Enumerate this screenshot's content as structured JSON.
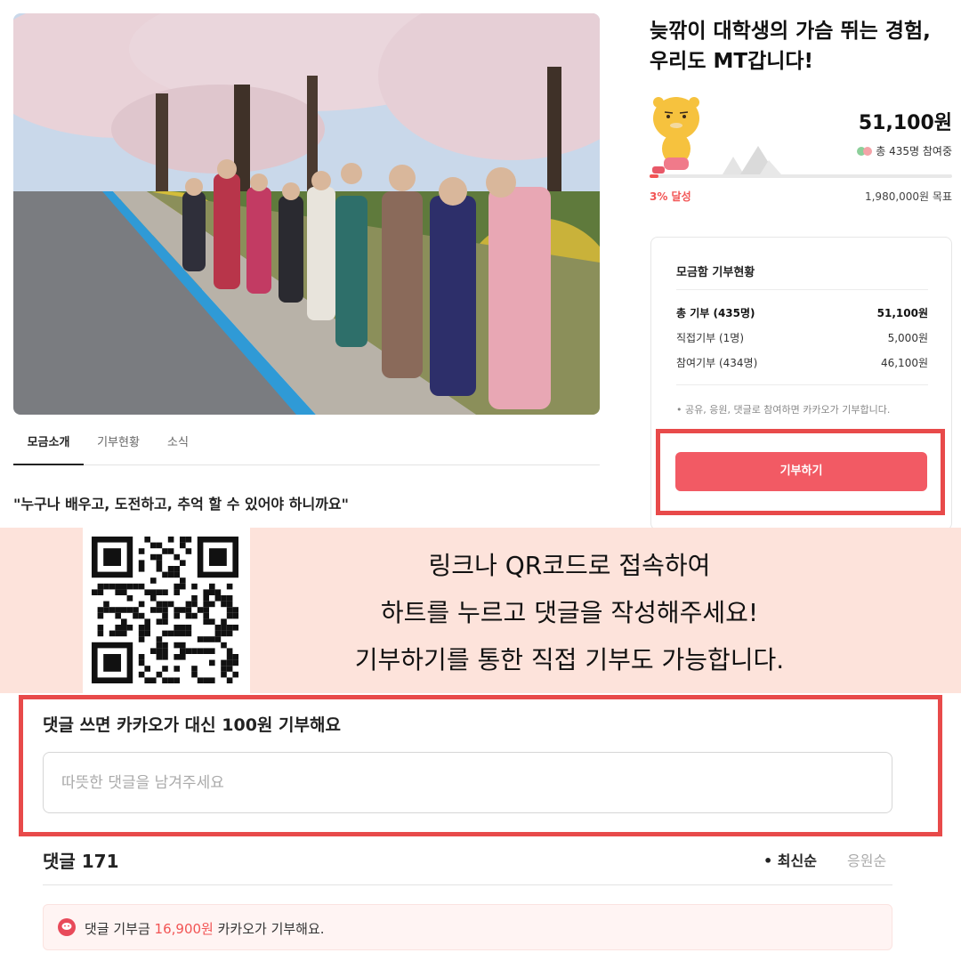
{
  "campaign": {
    "title_line1": "늦깎이 대학생의 가슴 뛰는 경험,",
    "title_line2": "우리도 MT갑니다!",
    "amount": "51,100원",
    "participants": "총 435명 참여중",
    "achieved": "3% 달성",
    "progress": 0.03,
    "goal": "1,980,000원 목표"
  },
  "tabs": [
    "모금소개",
    "기부현황",
    "소식"
  ],
  "quote": "\"누구나 배우고, 도전하고, 추억 할 수 있어야 하니까요\"",
  "status": {
    "title": "모금함 기부현황",
    "rows": [
      {
        "label": "총 기부 (435명)",
        "value": "51,100원"
      },
      {
        "label": "직접기부 (1명)",
        "value": "5,000원"
      },
      {
        "label": "참여기부 (434명)",
        "value": "46,100원"
      }
    ],
    "note1": "• 공유, 응원, 댓글로 참여하면 카카오가 기부합니다.",
    "donate_button": "기부하기"
  },
  "banner": {
    "line1": "링크나 QR코드로 접속하여",
    "line2": "하트를 누르고 댓글을 작성해주세요!",
    "line3": "기부하기를 통한 직접 기부도 가능합니다."
  },
  "comments": {
    "heading": "댓글 쓰면 카카오가 대신 100원 기부해요",
    "placeholder": "따뜻한 댓글을 남겨주세요",
    "count": "댓글 171",
    "sort_latest": "• 최신순",
    "sort_cheer": "응원순",
    "donation_prefix": "댓글 기부금 ",
    "donation_amount": "16,900원",
    "donation_suffix": " 카카오가 기부해요."
  },
  "colors": {
    "accent": "#f25a64",
    "highlight": "#e84a4a",
    "banner_bg": "#fde3db"
  }
}
